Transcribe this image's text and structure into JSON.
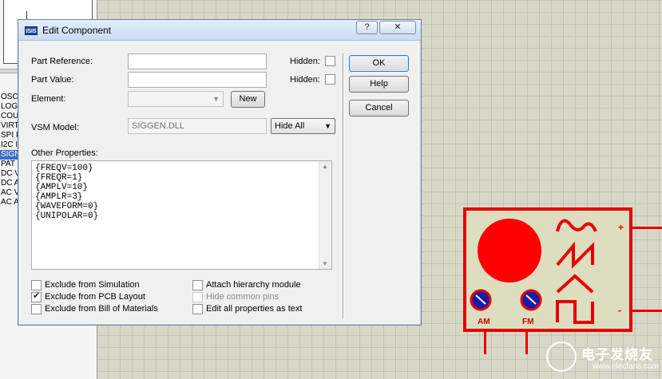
{
  "background": {
    "device_list": [
      "OSC",
      "LOG",
      "COU",
      "VIRT",
      "SPI I",
      "I2C I",
      "SIGN",
      "PAT",
      "DC V",
      "DC A",
      "AC V",
      "AC A"
    ],
    "selected_device_index": 6
  },
  "component": {
    "plus_label": "+",
    "minus_label": "-",
    "am_label": "AM",
    "fm_label": "FM",
    "accent_color": "#e60000"
  },
  "watermark": {
    "title": "电子发烧友",
    "url": "www.elecfans.com"
  },
  "dialog": {
    "icon_text": "ISIS",
    "title": "Edit Component",
    "help_icon": "?",
    "close_icon": "✕",
    "part_reference": {
      "label": "Part Reference:",
      "value": "",
      "hidden_label": "Hidden:",
      "hidden_checked": false
    },
    "part_value": {
      "label": "Part Value:",
      "value": "",
      "hidden_label": "Hidden:",
      "hidden_checked": false
    },
    "element": {
      "label": "Element:",
      "value": "",
      "new_button": "New"
    },
    "vsm_model": {
      "label": "VSM Model:",
      "value": "SIGGEN.DLL",
      "select_value": "Hide All"
    },
    "other_properties": {
      "label": "Other Properties:",
      "lines": [
        "{FREQV=100}",
        "{FREQR=1}",
        "{AMPLV=10}",
        "{AMPLR=3}",
        "{WAVEFORM=0}",
        "{UNIPOLAR=0}"
      ]
    },
    "options_left": [
      {
        "label": "Exclude from Simulation",
        "checked": false
      },
      {
        "label": "Exclude from PCB Layout",
        "checked": true
      },
      {
        "label": "Exclude from Bill of Materials",
        "checked": false
      }
    ],
    "options_right": [
      {
        "label": "Attach hierarchy module",
        "checked": false,
        "disabled": false
      },
      {
        "label": "Hide common pins",
        "checked": false,
        "disabled": true
      },
      {
        "label": "Edit all properties as text",
        "checked": false,
        "disabled": false
      }
    ],
    "buttons": {
      "ok": "OK",
      "help": "Help",
      "cancel": "Cancel"
    }
  }
}
